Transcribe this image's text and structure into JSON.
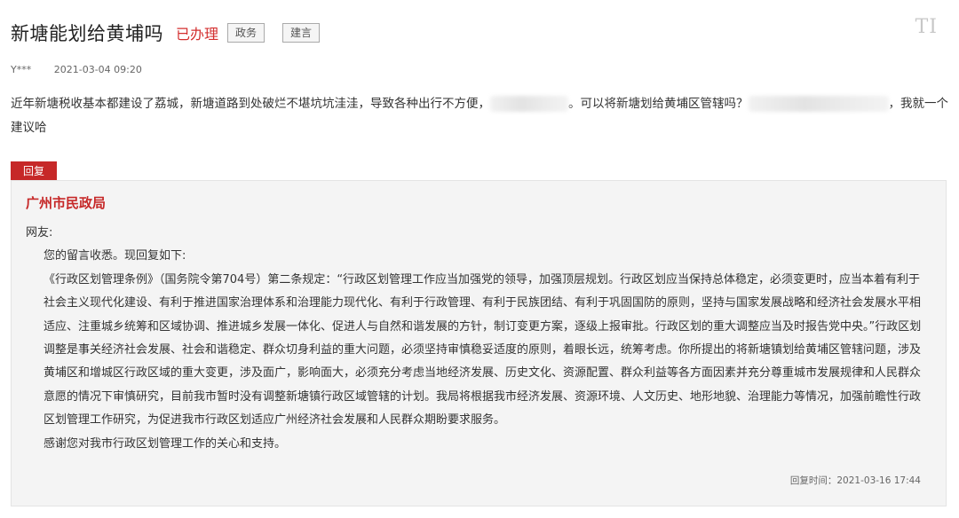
{
  "header": {
    "title": "新塘能划给黄埔吗",
    "status": "已办理",
    "tags": [
      "政务",
      "建言"
    ],
    "font_toggle": "TI"
  },
  "meta": {
    "user": "Y***",
    "date": "2021-03-04 09:20"
  },
  "question": {
    "part1": "近年新塘税收基本都建设了荔城，新塘道路到处破烂不堪坑坑洼洼，导致各种出行不方便，",
    "part2": "。可以将新塘划给黄埔区管辖吗？",
    "part3": "，我就一个建议哈"
  },
  "reply": {
    "tag": "回复",
    "org": "广州市民政局",
    "greeting": "网友:",
    "p1": "您的留言收悉。现回复如下:",
    "p2": "《行政区划管理条例》（国务院令第704号）第二条规定：“行政区划管理工作应当加强党的领导，加强顶层规划。行政区划应当保持总体稳定，必须变更时，应当本着有利于社会主义现代化建设、有利于推进国家治理体系和治理能力现代化、有利于行政管理、有利于民族团结、有利于巩固国防的原则，坚持与国家发展战略和经济社会发展水平相适应、注重城乡统筹和区域协调、推进城乡发展一体化、促进人与自然和谐发展的方针，制订变更方案，逐级上报审批。行政区划的重大调整应当及时报告党中央。”行政区划调整是事关经济社会发展、社会和谐稳定、群众切身利益的重大问题，必须坚持审慎稳妥适度的原则，着眼长远，统筹考虑。你所提出的将新塘镇划给黄埔区管辖问题，涉及黄埔区和增城区行政区域的重大变更，涉及面广，影响面大，必须充分考虑当地经济发展、历史文化、资源配置、群众利益等各方面因素并充分尊重城市发展规律和人民群众意愿的情况下审慎研究，目前我市暂时没有调整新塘镇行政区域管辖的计划。我局将根据我市经济发展、资源环境、人文历史、地形地貌、治理能力等情况，加强前瞻性行政区划管理工作研究，为促进我市行政区划适应广州经济社会发展和人民群众期盼要求服务。",
    "p3": "感谢您对我市行政区划管理工作的关心和支持。",
    "time": "回复时间：2021-03-16 17:44"
  }
}
